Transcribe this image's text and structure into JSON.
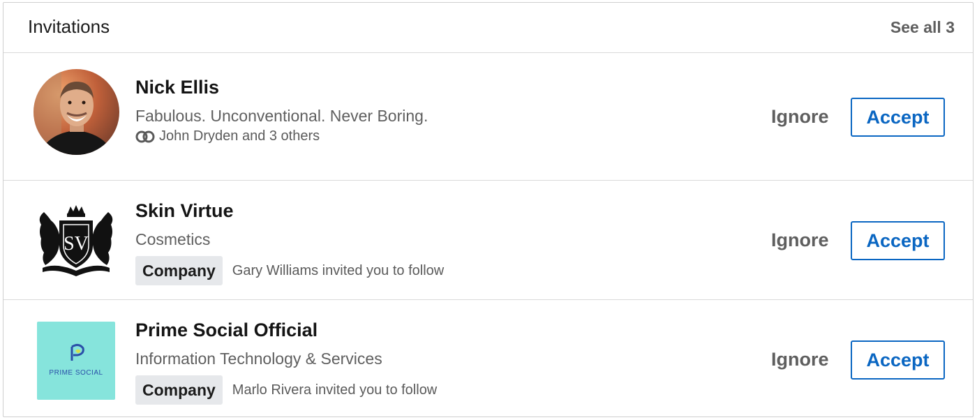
{
  "header": {
    "title": "Invitations",
    "see_all": "See all 3"
  },
  "invitations": [
    {
      "name": "Nick Ellis",
      "subtitle": "Fabulous. Unconventional. Never Boring.",
      "connections": "John Dryden and 3 others",
      "ignore": "Ignore",
      "accept": "Accept"
    },
    {
      "name": "Skin Virtue",
      "subtitle": "Cosmetics",
      "badge": "Company",
      "invited": "Gary Williams invited you to follow",
      "logo_monogram": "SV",
      "ignore": "Ignore",
      "accept": "Accept"
    },
    {
      "name": "Prime Social Official",
      "subtitle": "Information Technology & Services",
      "badge": "Company",
      "invited": "Marlo Rivera invited you to follow",
      "logo_text": "PRIME SOCIAL",
      "ignore": "Ignore",
      "accept": "Accept"
    }
  ],
  "colors": {
    "accent": "#0a66c2",
    "logo_bg": "#86e4dc"
  }
}
